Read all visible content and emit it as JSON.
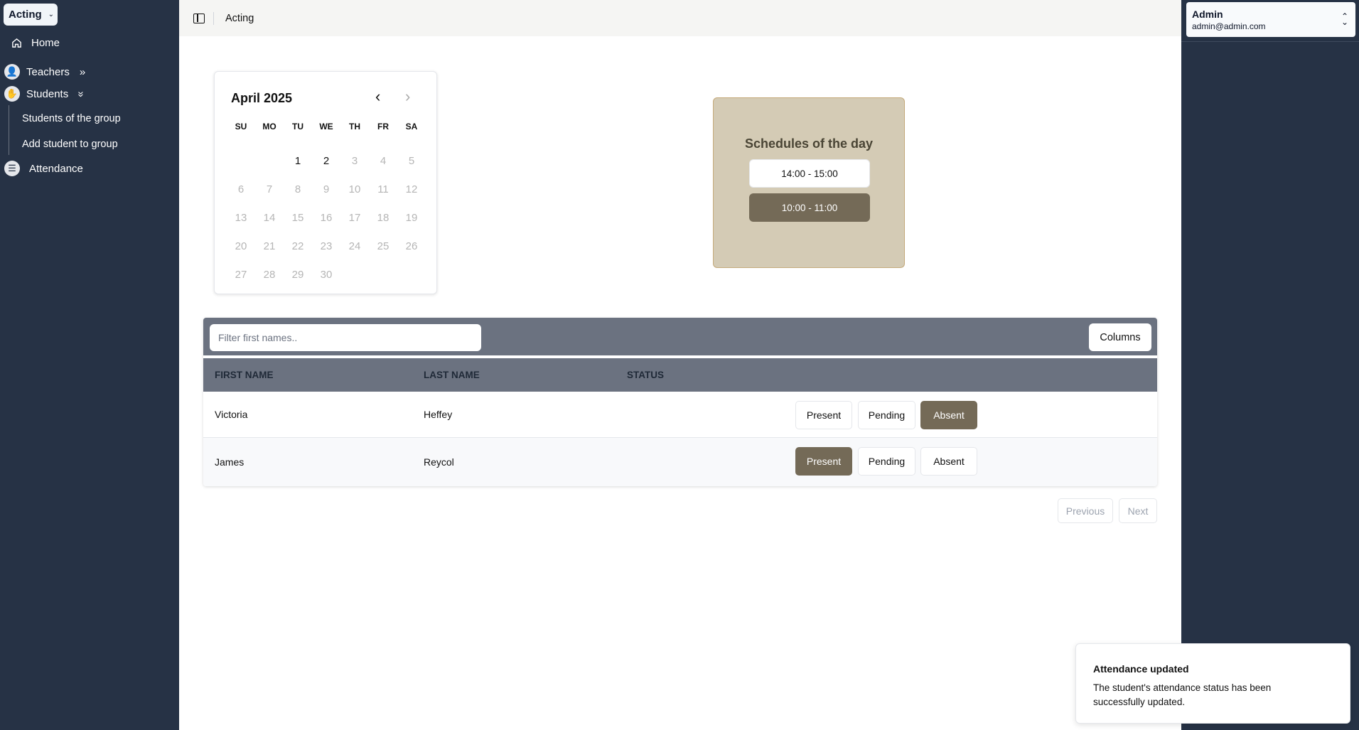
{
  "sidebar": {
    "team": "Acting",
    "items": [
      {
        "label": "Home",
        "icon": "home-icon"
      },
      {
        "label": "Teachers",
        "icon": "person-icon",
        "arrow": "»"
      },
      {
        "label": "Students",
        "icon": "student-icon",
        "arrow": "»"
      },
      {
        "label": "Attendance",
        "icon": "attendance-icon"
      }
    ],
    "sub_items": [
      "Students of the group",
      "Add student to group"
    ]
  },
  "topbar": {
    "breadcrumb": "Acting"
  },
  "user": {
    "name": "Admin",
    "email": "admin@admin.com"
  },
  "calendar": {
    "title": "April 2025",
    "weekdays": [
      "SU",
      "MO",
      "TU",
      "WE",
      "TH",
      "FR",
      "SA"
    ],
    "leading_blanks": 2,
    "days": [
      1,
      2,
      3,
      4,
      5,
      6,
      7,
      8,
      9,
      10,
      11,
      12,
      13,
      14,
      15,
      16,
      17,
      18,
      19,
      20,
      21,
      22,
      23,
      24,
      25,
      26,
      27,
      28,
      29,
      30
    ],
    "active_days": [
      1,
      2
    ]
  },
  "schedules": {
    "title": "Schedules of the day",
    "slots": [
      {
        "label": "14:00 - 15:00",
        "selected": false
      },
      {
        "label": "10:00 - 11:00",
        "selected": true
      }
    ]
  },
  "table": {
    "filter_placeholder": "Filter first names..",
    "columns_button": "Columns",
    "headers": {
      "first_name": "FIRST NAME",
      "last_name": "LAST NAME",
      "status": "STATUS"
    },
    "status_options": [
      "Present",
      "Pending",
      "Absent"
    ],
    "rows": [
      {
        "first_name": "Victoria",
        "last_name": "Heffey",
        "status": "Absent"
      },
      {
        "first_name": "James",
        "last_name": "Reycol",
        "status": "Present"
      }
    ],
    "pagination": {
      "previous": "Previous",
      "next": "Next"
    }
  },
  "toast": {
    "title": "Attendance updated",
    "description": "The student's attendance status has been successfully updated."
  },
  "colors": {
    "sidebar_bg": "#263245",
    "accent_brown": "#746a57",
    "schedule_bg": "#d4cbb5",
    "table_header_bg": "#6b7280"
  }
}
